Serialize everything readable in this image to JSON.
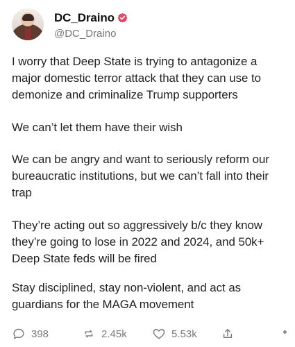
{
  "user": {
    "display_name": "DC_Draino",
    "username": "@DC_Draino"
  },
  "post": {
    "paragraphs": [
      "I worry that Deep State is trying to antagonize a major domestic terror attack that they can use to demonize and criminalize Trump supporters",
      "We can’t let them have their wish",
      "We can be angry and want to seriously reform our bureaucratic institutions, but we can’t fall into their trap",
      "They’re acting out so aggressively b/c they know they’re going to lose in 2022 and 2024, and 50k+ Deep State feds will be fired",
      "Stay disciplined, stay non-violent, and act as guardians for the MAGA movement"
    ]
  },
  "actions": {
    "reply_count": "398",
    "repost_count": "2.45k",
    "like_count": "5.53k"
  },
  "icons": {
    "verified": "verified-badge-icon",
    "reply": "reply-icon",
    "repost": "repost-icon",
    "like": "heart-icon",
    "share": "share-icon",
    "more": "more-dot-icon"
  },
  "colors": {
    "verified_badge": "#e04b68",
    "muted_text": "#767676",
    "body_text": "#222222"
  }
}
